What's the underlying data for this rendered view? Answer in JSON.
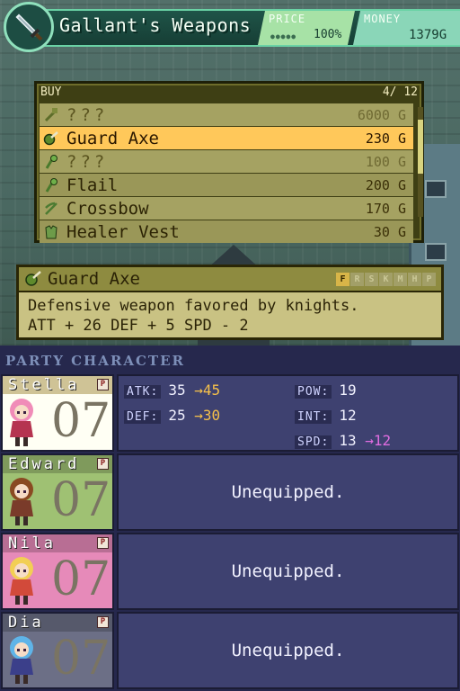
{
  "shop": {
    "title": "Gallant's Weapons",
    "price_label": "PRICE",
    "price_value": "100%",
    "money_label": "MONEY",
    "money_value": "1379G",
    "icon": "sword-icon"
  },
  "buy": {
    "label": "BUY",
    "count": "4/ 12",
    "items": [
      {
        "name": "???",
        "price": "6000 G",
        "icon": "hammer-icon",
        "selected": false,
        "unknown": true
      },
      {
        "name": "Guard Axe",
        "price": "230 G",
        "icon": "axe-icon",
        "selected": true,
        "unknown": false
      },
      {
        "name": "???",
        "price": "100 G",
        "icon": "flail-icon",
        "selected": false,
        "unknown": true
      },
      {
        "name": "Flail",
        "price": "200 G",
        "icon": "flail-icon",
        "selected": false,
        "unknown": false
      },
      {
        "name": "Crossbow",
        "price": "170 G",
        "icon": "crossbow-icon",
        "selected": false,
        "unknown": false
      },
      {
        "name": "Healer Vest",
        "price": "30 G",
        "icon": "vest-icon",
        "selected": false,
        "unknown": false
      }
    ]
  },
  "detail": {
    "name": "Guard Axe",
    "icon": "axe-icon",
    "flags": [
      {
        "letter": "F",
        "active": true
      },
      {
        "letter": "R",
        "active": false
      },
      {
        "letter": "S",
        "active": false
      },
      {
        "letter": "K",
        "active": false
      },
      {
        "letter": "M",
        "active": false
      },
      {
        "letter": "H",
        "active": false
      },
      {
        "letter": "P",
        "active": false
      }
    ],
    "line1": "Defensive weapon favored by knights.",
    "line2": "ATT + 26  DEF + 5  SPD - 2"
  },
  "party": {
    "title": "PARTY CHARACTER",
    "members": [
      {
        "name": "Stella",
        "badge": "P",
        "level": "07",
        "color": "#cfc396",
        "stats": {
          "atk_label": "ATK:",
          "atk": "35",
          "atk_new": "→45",
          "def_label": "DEF:",
          "def": "25",
          "def_new": "→30",
          "pow_label": "POW:",
          "pow": "19",
          "int_label": "INT:",
          "int": "12",
          "spd_label": "SPD:",
          "spd": "13",
          "spd_new": "→12"
        }
      },
      {
        "name": "Edward",
        "badge": "P",
        "level": "07",
        "color": "#7f9a5c",
        "status": "Unequipped."
      },
      {
        "name": "Nila",
        "badge": "P",
        "level": "07",
        "color": "#b86e94",
        "status": "Unequipped."
      },
      {
        "name": "Dia",
        "badge": "P",
        "level": "07",
        "color": "#56596b",
        "status": "Unequipped."
      }
    ]
  }
}
